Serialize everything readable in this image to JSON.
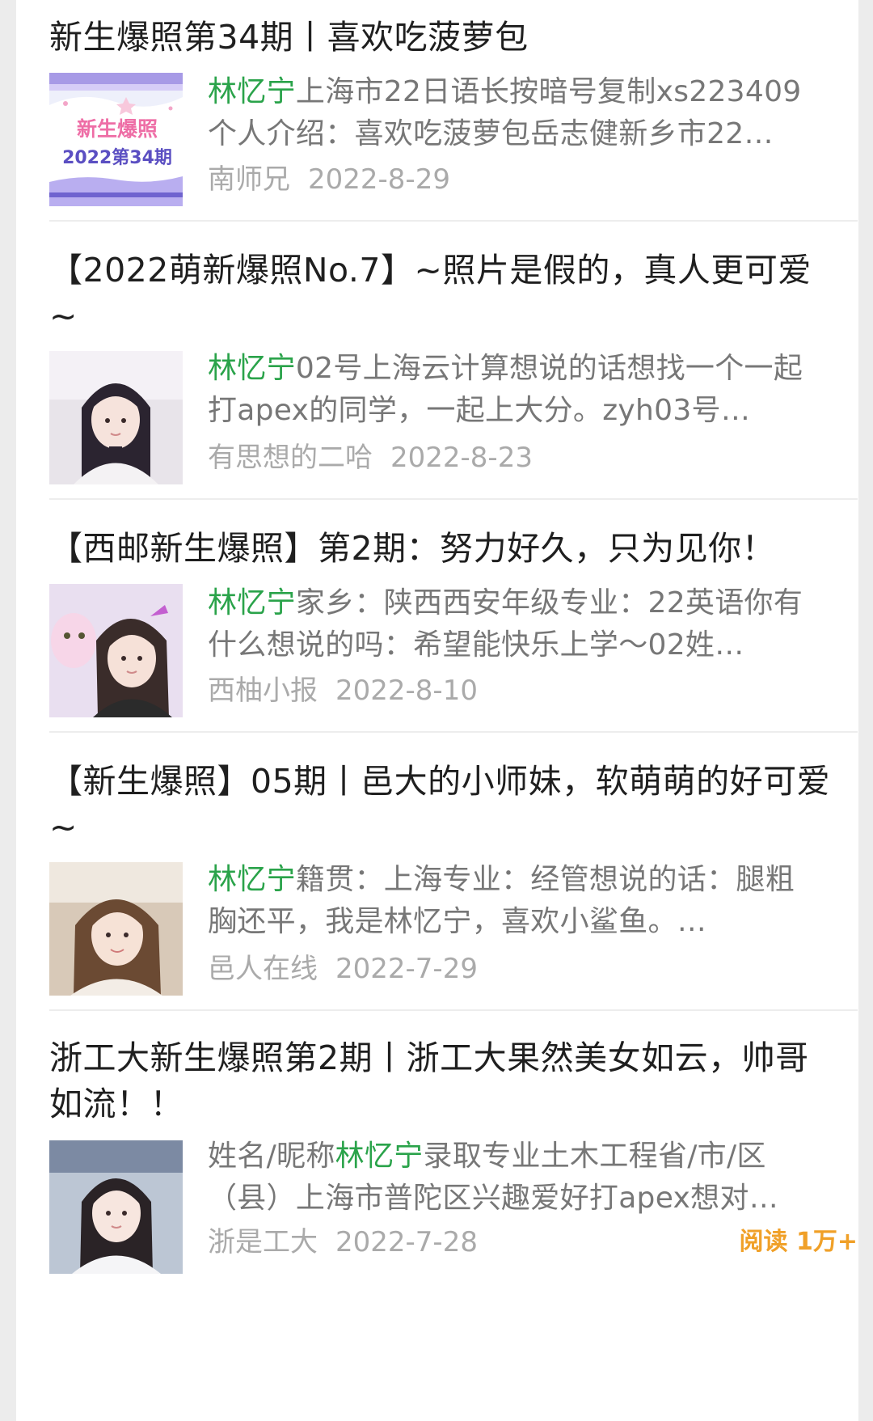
{
  "articles": [
    {
      "title": "新生爆照第34期丨喜欢吃菠萝包",
      "snippet_pre": "",
      "name": "林忆宁",
      "snippet_post": "上海市22日语长按暗号复制xs223409个人介绍：喜欢吃菠萝包岳志健新乡市22…",
      "source": "南师兄",
      "date": "2022-8-29",
      "thumb": {
        "type": "banner",
        "banner_text": "新生爆照",
        "banner_sub": "2022第34期"
      }
    },
    {
      "title": "【2022萌新爆照No.7】~照片是假的，真人更可爱~",
      "snippet_pre": "",
      "name": "林忆宁",
      "snippet_post": "02号上海云计算想说的话想找一个一起打apex的同学，一起上大分。zyh03号…",
      "source": "有思想的二哈",
      "date": "2022-8-23",
      "thumb": {
        "type": "photo",
        "bg": "#e8e4ea",
        "hair": "#2b2430",
        "shirt": "#f4f2f4"
      }
    },
    {
      "title": "【西邮新生爆照】第2期：努力好久，只为见你！",
      "snippet_pre": "",
      "name": "林忆宁",
      "snippet_post": "家乡：陕西西安年级专业：22英语你有什么想说的吗：希望能快乐上学～02姓…",
      "source": "西柚小报",
      "date": "2022-8-10",
      "thumb": {
        "type": "photo",
        "bg": "#e9dff0",
        "hair": "#3a2c2a",
        "shirt": "#2b2b2b"
      }
    },
    {
      "title": "【新生爆照】05期丨邑大的小师妹，软萌萌的好可爱~",
      "snippet_pre": "",
      "name": "林忆宁",
      "snippet_post": "籍贯：上海专业：经管想说的话：腿粗胸还平，我是林忆宁，喜欢小鲨鱼。…",
      "source": "邑人在线",
      "date": "2022-7-29",
      "thumb": {
        "type": "photo",
        "bg": "#d8c9b8",
        "hair": "#6b4a33",
        "shirt": "#f3ede6"
      }
    },
    {
      "title": "浙工大新生爆照第2期丨浙工大果然美女如云，帅哥如流！！",
      "snippet_pre": "姓名/昵称",
      "name": "林忆宁",
      "snippet_post": "录取专业土木工程省/市/区（县）上海市普陀区兴趣爱好打apex想对…",
      "source": "浙是工大",
      "date": "2022-7-28",
      "reads": "阅读 1万+",
      "thumb": {
        "type": "photo",
        "bg": "#bcc6d4",
        "hair": "#2a2326",
        "shirt": "#f5f5f7"
      }
    }
  ],
  "colors": {
    "name_highlight": "#2aa34a",
    "reads": "#f0a028",
    "meta": "#aaaaaa"
  }
}
